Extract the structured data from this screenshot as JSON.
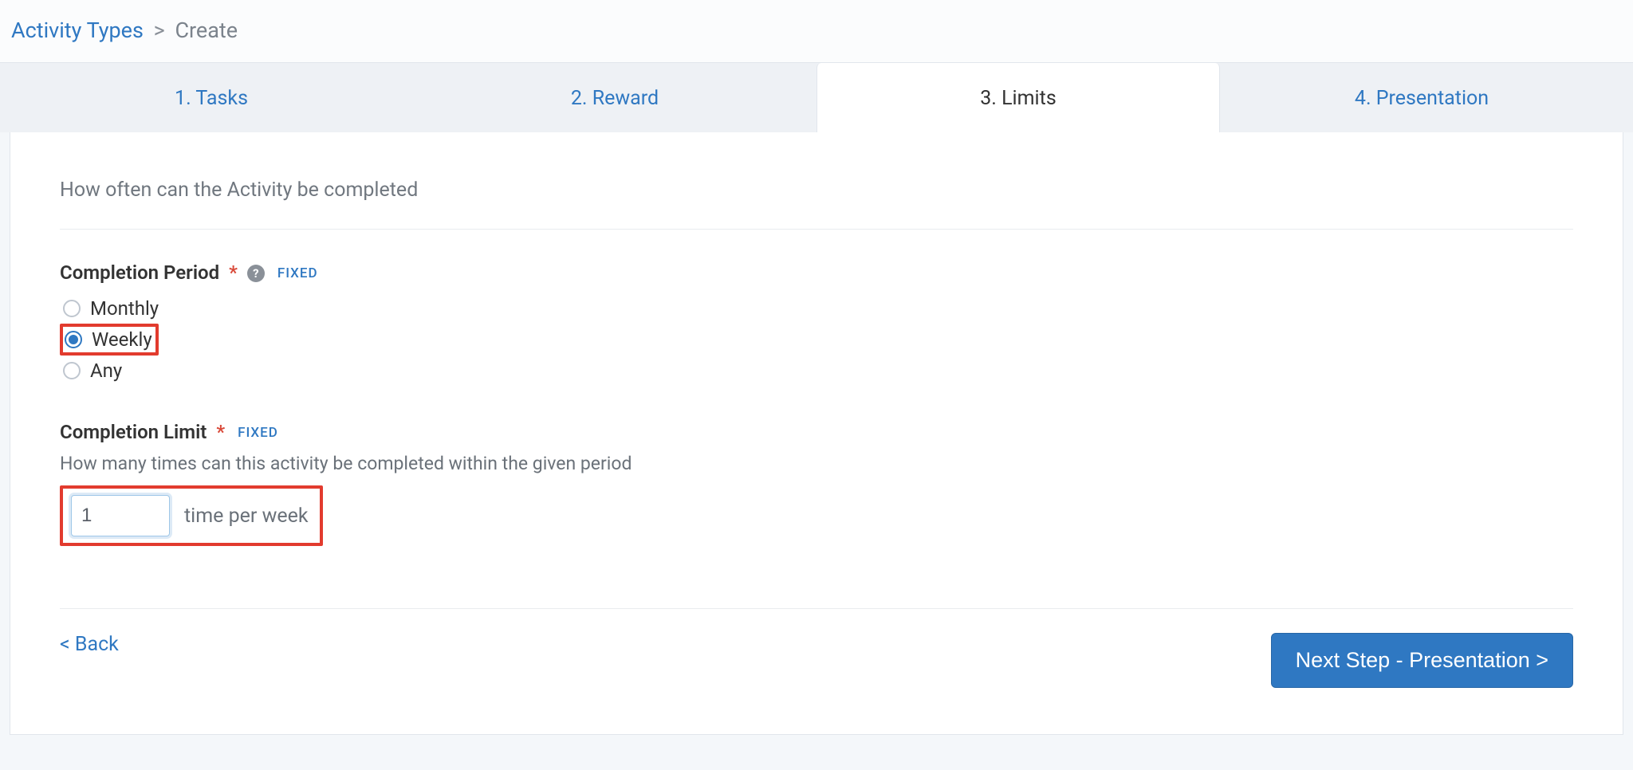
{
  "breadcrumb": {
    "root_label": "Activity Types",
    "separator": ">",
    "current_label": "Create"
  },
  "tabs": [
    {
      "label": "1. Tasks",
      "active": false
    },
    {
      "label": "2. Reward",
      "active": false
    },
    {
      "label": "3. Limits",
      "active": true
    },
    {
      "label": "4. Presentation",
      "active": false
    }
  ],
  "section": {
    "title": "How often can the Activity be completed"
  },
  "completion_period": {
    "label": "Completion Period",
    "required_marker": "*",
    "fixed_badge": "FIXED",
    "options": [
      {
        "label": "Monthly",
        "selected": false,
        "highlighted": false
      },
      {
        "label": "Weekly",
        "selected": true,
        "highlighted": true
      },
      {
        "label": "Any",
        "selected": false,
        "highlighted": false
      }
    ]
  },
  "completion_limit": {
    "label": "Completion Limit",
    "required_marker": "*",
    "fixed_badge": "FIXED",
    "help_text": "How many times can this activity be completed within the given period",
    "value": "1",
    "suffix": "time per week"
  },
  "footer": {
    "back_label": "< Back",
    "next_label": "Next Step - Presentation >"
  }
}
